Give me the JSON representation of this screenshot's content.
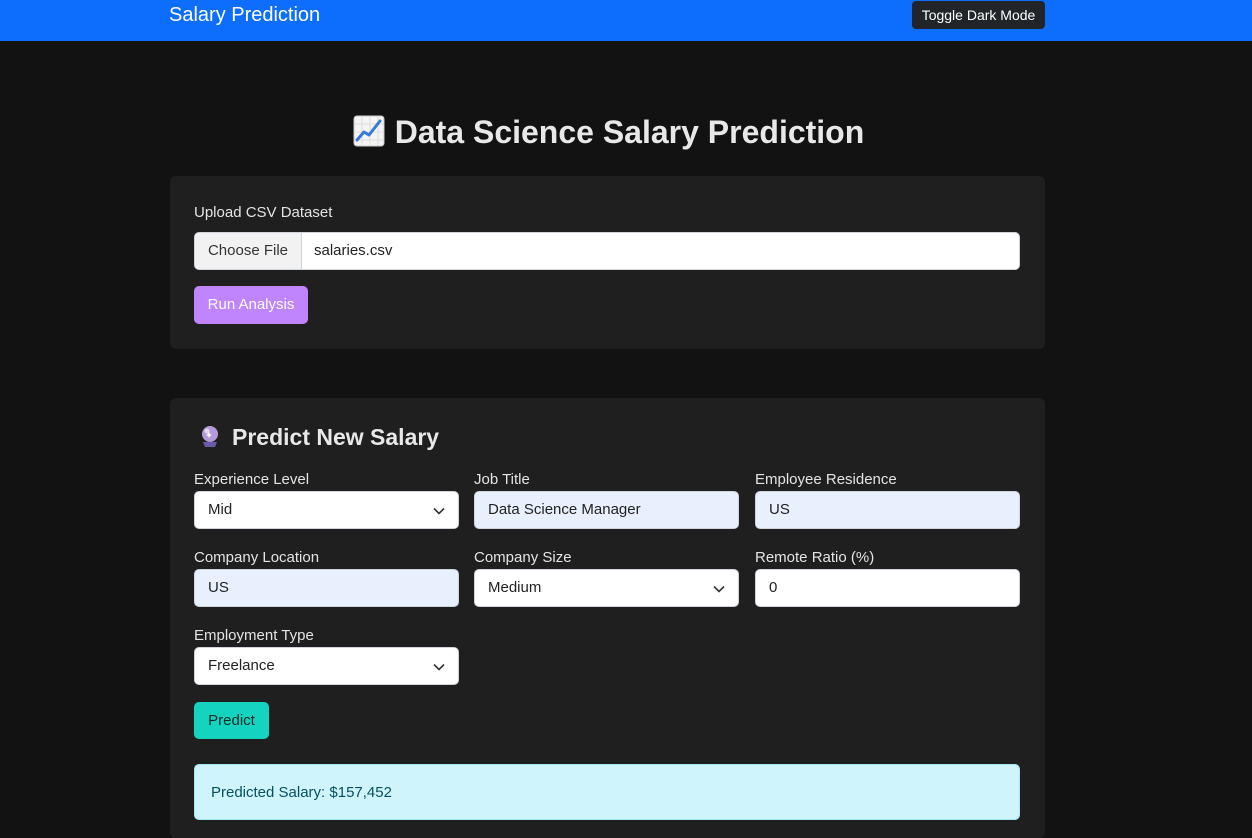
{
  "navbar": {
    "brand": "Salary Prediction",
    "toggle_label": "Toggle Dark Mode"
  },
  "page": {
    "title": "Data Science Salary Prediction",
    "title_icon": "chart-increasing-icon"
  },
  "upload": {
    "label": "Upload CSV Dataset",
    "choose_file_label": "Choose File",
    "file_name": "salaries.csv",
    "run_label": "Run Analysis"
  },
  "predict": {
    "title": "Predict New Salary",
    "title_icon": "crystal-ball-icon",
    "fields": {
      "experience_level": {
        "label": "Experience Level",
        "value": "Mid"
      },
      "job_title": {
        "label": "Job Title",
        "value": "Data Science Manager"
      },
      "employee_residence": {
        "label": "Employee Residence",
        "value": "US"
      },
      "company_location": {
        "label": "Company Location",
        "value": "US"
      },
      "company_size": {
        "label": "Company Size",
        "value": "Medium"
      },
      "remote_ratio": {
        "label": "Remote Ratio (%)",
        "value": "0"
      },
      "employment_type": {
        "label": "Employment Type",
        "value": "Freelance"
      }
    },
    "predict_label": "Predict",
    "result": "Predicted Salary: $157,452"
  },
  "colors": {
    "navbar": "#0d6efd",
    "background": "#121212",
    "card": "#1f1f1f",
    "run_button": "#c084fc",
    "predict_button": "#14d4c0",
    "result_bg": "#cff4fc"
  }
}
